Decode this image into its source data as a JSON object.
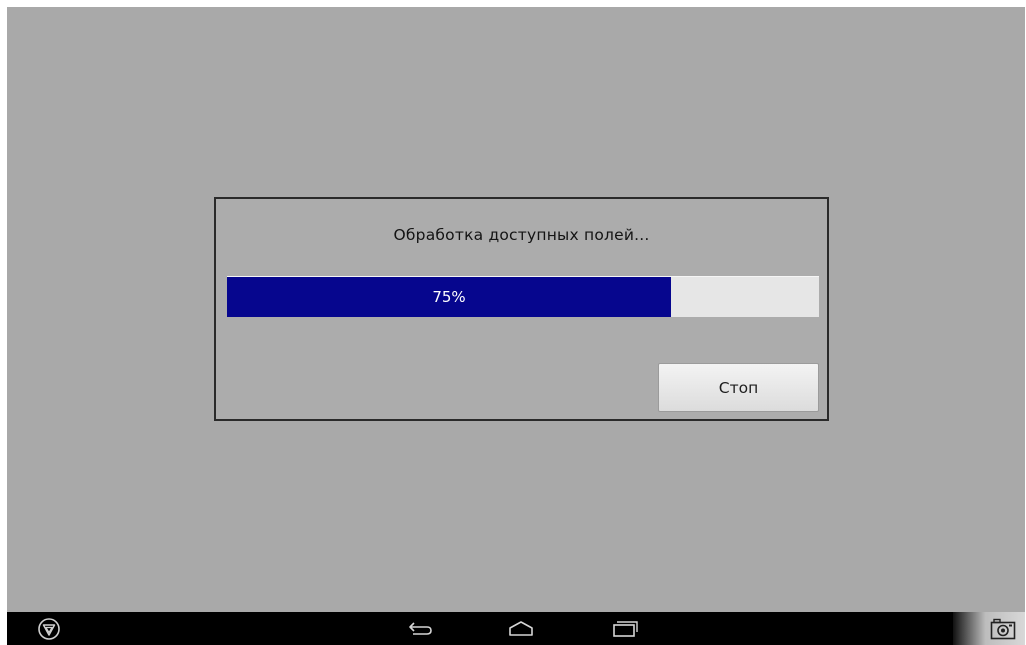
{
  "dialog": {
    "message": "Обработка доступных полей...",
    "progress": {
      "percent": 75,
      "label": "75%"
    },
    "stop_label": "Стоп"
  },
  "navbar": {
    "icons": {
      "left": "launcher-logo-icon",
      "back": "back-icon",
      "home": "home-icon",
      "recents": "recents-icon",
      "screenshot": "camera-icon"
    }
  },
  "colors": {
    "background": "#a9a9a9",
    "progress_fill": "#06068e",
    "progress_track": "#e6e6e6",
    "navbar": "#000000"
  }
}
